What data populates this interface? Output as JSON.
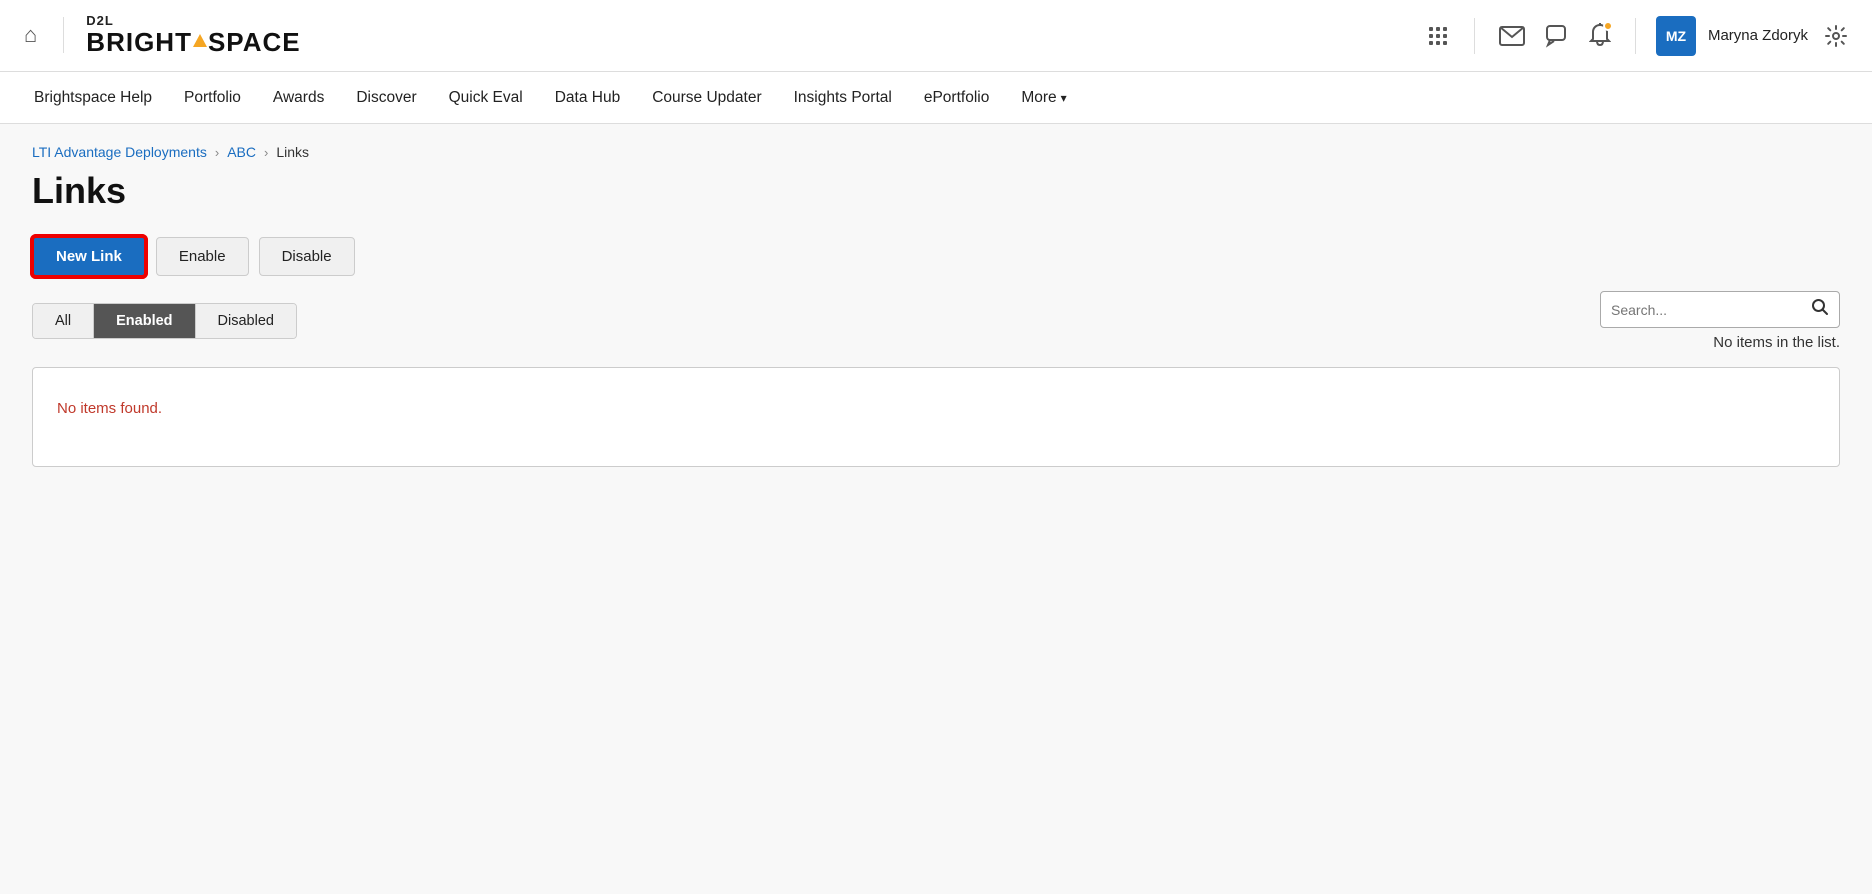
{
  "header": {
    "home_icon": "⌂",
    "logo_d2l": "D2L",
    "logo_bright": "BRIGHT",
    "logo_space": "SPACE",
    "icons": {
      "apps": "⊞",
      "mail": "✉",
      "chat": "💬",
      "bell": "🔔",
      "settings": "⚙"
    },
    "avatar_initials": "MZ",
    "user_name": "Maryna Zdoryk"
  },
  "nav": {
    "items": [
      {
        "label": "Brightspace Help"
      },
      {
        "label": "Portfolio"
      },
      {
        "label": "Awards"
      },
      {
        "label": "Discover"
      },
      {
        "label": "Quick Eval"
      },
      {
        "label": "Data Hub"
      },
      {
        "label": "Course Updater"
      },
      {
        "label": "Insights Portal"
      },
      {
        "label": "ePortfolio"
      },
      {
        "label": "More"
      }
    ]
  },
  "breadcrumb": {
    "items": [
      {
        "label": "LTI Advantage Deployments",
        "href": "#"
      },
      {
        "label": "ABC",
        "href": "#"
      },
      {
        "label": "Links"
      }
    ]
  },
  "page": {
    "title": "Links",
    "toolbar": {
      "new_link": "New Link",
      "enable": "Enable",
      "disable": "Disable"
    },
    "filter_tabs": [
      {
        "label": "All",
        "active": false
      },
      {
        "label": "Enabled",
        "active": true
      },
      {
        "label": "Disabled",
        "active": false
      }
    ],
    "search_placeholder": "Search...",
    "no_items_label": "No items in the list.",
    "no_items_found": "No items found."
  }
}
